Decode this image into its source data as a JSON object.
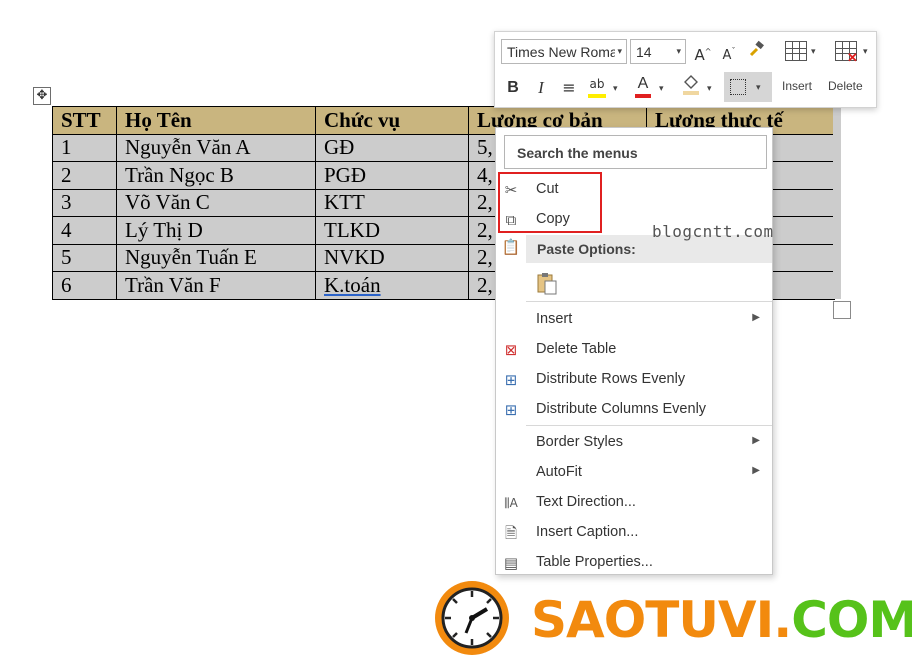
{
  "table": {
    "headers": [
      "STT",
      "Họ Tên",
      "Chức vụ",
      "Lương cơ bản",
      "Lương thực tế"
    ],
    "rows": [
      {
        "stt": "1",
        "name": "Nguyễn Văn A",
        "role": "GĐ",
        "salary": "5,"
      },
      {
        "stt": "2",
        "name": "Trần Ngọc B",
        "role": "PGĐ",
        "salary": "4,"
      },
      {
        "stt": "3",
        "name": "Võ Văn C",
        "role": "KTT",
        "salary": "2,"
      },
      {
        "stt": "4",
        "name": "Lý Thị D",
        "role": "TLKD",
        "salary": "2,"
      },
      {
        "stt": "5",
        "name": "Nguyễn Tuấn E",
        "role": "NVKD",
        "salary": "2,"
      },
      {
        "stt": "6",
        "name": "Trần Văn F",
        "role": "K.toán",
        "salary": "2,"
      }
    ],
    "move_handle_icon": "move-arrows-icon"
  },
  "toolbar": {
    "font_name": "Times New Roma",
    "font_size": "14",
    "insert_label": "Insert",
    "delete_label": "Delete",
    "bold_label": "B",
    "italic_label": "I",
    "font_color_label": "A",
    "highlight_color": "#ffee00",
    "font_color": "#e02020"
  },
  "context_menu": {
    "search_placeholder": "Search the menus",
    "cut": "Cut",
    "copy": "Copy",
    "paste_options": "Paste Options:",
    "insert": "Insert",
    "delete_table": "Delete Table",
    "distribute_rows": "Distribute Rows Evenly",
    "distribute_columns": "Distribute Columns Evenly",
    "border_styles": "Border Styles",
    "autofit": "AutoFit",
    "text_direction": "Text Direction...",
    "insert_caption": "Insert Caption...",
    "table_properties": "Table Properties..."
  },
  "watermark": "blogcntt.com",
  "logo": {
    "part1": "SAOTUVI.",
    "part2": "COM",
    "orange": "#f28a0e",
    "green": "#56c21a"
  }
}
